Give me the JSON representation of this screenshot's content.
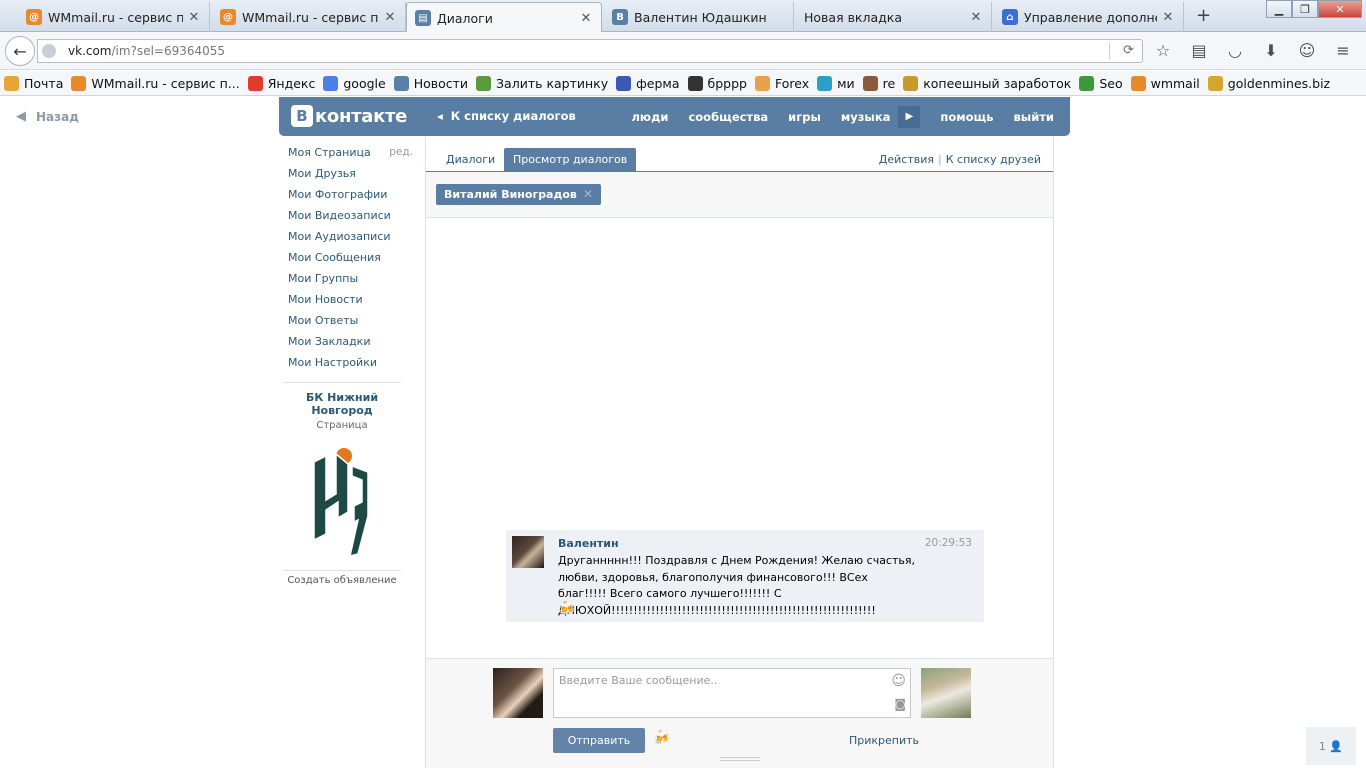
{
  "browser": {
    "tabs": [
      {
        "title": "WMmail.ru - сервис по...",
        "icon": "wmmail-icon",
        "color": "#e88a2a",
        "active": false
      },
      {
        "title": "WMmail.ru - сервис по...",
        "icon": "wmmail-icon",
        "color": "#e88a2a",
        "active": false
      },
      {
        "title": "Диалоги",
        "icon": "vk-chat-icon",
        "color": "#5b80a8",
        "active": true
      },
      {
        "title": "Валентин Юдашкин",
        "icon": "vk-icon",
        "color": "#5b80a8",
        "active": false
      },
      {
        "title": "Новая вкладка",
        "icon": "",
        "color": "",
        "active": false
      },
      {
        "title": "Управление дополнен...",
        "icon": "addons-icon",
        "color": "#3d6fd1",
        "active": false
      }
    ],
    "new_tab_label": "+",
    "url_host": "vk.com",
    "url_path": "/im?sel=69364055",
    "bookmarks": [
      {
        "label": "Почта",
        "icon": "mail-icon",
        "color": "#e7a43a"
      },
      {
        "label": "WMmail.ru - сервис п...",
        "icon": "wmmail-icon",
        "color": "#e88a2a"
      },
      {
        "label": "Яндекс",
        "icon": "yandex-icon",
        "color": "#e23b2e"
      },
      {
        "label": "google",
        "icon": "google-icon",
        "color": "#4a7fe6"
      },
      {
        "label": "Новости",
        "icon": "vk-icon",
        "color": "#5b80a8"
      },
      {
        "label": "Залить картинку",
        "icon": "image-upload-icon",
        "color": "#5a9a3a"
      },
      {
        "label": "ферма",
        "icon": "farm-icon",
        "color": "#3a59b5"
      },
      {
        "label": "бpppp",
        "icon": "film-icon",
        "color": "#333333"
      },
      {
        "label": "Forex",
        "icon": "forex-icon",
        "color": "#e8a04a"
      },
      {
        "label": "ми",
        "icon": "mi-icon",
        "color": "#2aa0c9"
      },
      {
        "label": "re",
        "icon": "re-icon",
        "color": "#8a5a3a"
      },
      {
        "label": "копеешный заработок",
        "icon": "coin-icon",
        "color": "#c79a2a"
      },
      {
        "label": "Seo",
        "icon": "seo-icon",
        "color": "#3a9a3a"
      },
      {
        "label": "wmmail",
        "icon": "wmmail-icon",
        "color": "#e88a2a"
      },
      {
        "label": "goldenmines.biz",
        "icon": "gold-icon",
        "color": "#d4a62a"
      }
    ]
  },
  "vk": {
    "back_label": "Назад",
    "logo_text": "контакте",
    "logo_letter": "В",
    "to_dialogs": "К списку диалогов",
    "nav": [
      "люди",
      "сообщества",
      "игры",
      "музыка",
      "помощь",
      "выйти"
    ],
    "menu": [
      "Моя Страница",
      "Мои Друзья",
      "Мои Фотографии",
      "Мои Видеозаписи",
      "Мои Аудиозаписи",
      "Мои Сообщения",
      "Мои Группы",
      "Мои Новости",
      "Мои Ответы",
      "Мои Закладки",
      "Мои Настройки"
    ],
    "edit_label": "ред.",
    "group_name": "БК Нижний Новгород",
    "group_type": "Страница",
    "create_ad": "Создать объявление",
    "tabs": [
      "Диалоги",
      "Просмотр диалогов"
    ],
    "actions": "Действия",
    "to_friends": "К списку друзей",
    "chip_name": "Виталий Виноградов",
    "message": {
      "author": "Валентин",
      "time": "20:29:53",
      "text": "Друганнннн!!! Поздравля с Днем Рождения! Желаю счастья, любви, здоровья, благополучия финансового!!! ВСех благ!!!!! Всего самого лучшего!!!!!!! С ДНЮХОЙ!!!!!!!!!!!!!!!!!!!!!!!!!!!!!!!!!!!!!!!!!!!!!!!!!!!!!!!!!!!!",
      "emoji": "🍻"
    },
    "placeholder": "Введите Ваше сообщение..",
    "send": "Отправить",
    "attach": "Прикрепить",
    "pager": "1"
  },
  "colors": {
    "vk_blue": "#597da3",
    "link": "#2b587a"
  }
}
